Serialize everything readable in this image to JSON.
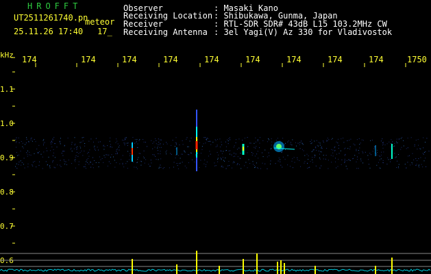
{
  "header": {
    "brand": "HROFFT",
    "filename": "UT2511261740.pn",
    "mode": "meteor",
    "datetime": "25.11.26 17:40",
    "counter": "17_",
    "info": [
      {
        "label": "Observer",
        "value": ": Masaki Kano"
      },
      {
        "label": "Receiving Location",
        "value": ": Shibukawa, Gunma, Japan"
      },
      {
        "label": "Receiver",
        "value": ": RTL-SDR SDR# 43dB L15 103.2MHz CW"
      },
      {
        "label": "Receiving Antenna",
        "value": ": 3el Yagi(V) Az 330 for Vladivostok"
      }
    ]
  },
  "time_axis": {
    "ticks": [
      "174",
      "174",
      "174",
      "174",
      "174",
      "174",
      "174",
      "174",
      "174",
      "1750"
    ]
  },
  "freq_axis": {
    "unit": "kHz",
    "ticks": [
      "1.1",
      "1.0",
      "0.9",
      "0.8",
      "0.7",
      "0.6"
    ]
  },
  "colors": {
    "background": "#000000",
    "axis_text": "#ffff33",
    "header_text": "#ffffff",
    "brand_text": "#2ecc40",
    "noise_band": "#1a2a6a"
  }
}
